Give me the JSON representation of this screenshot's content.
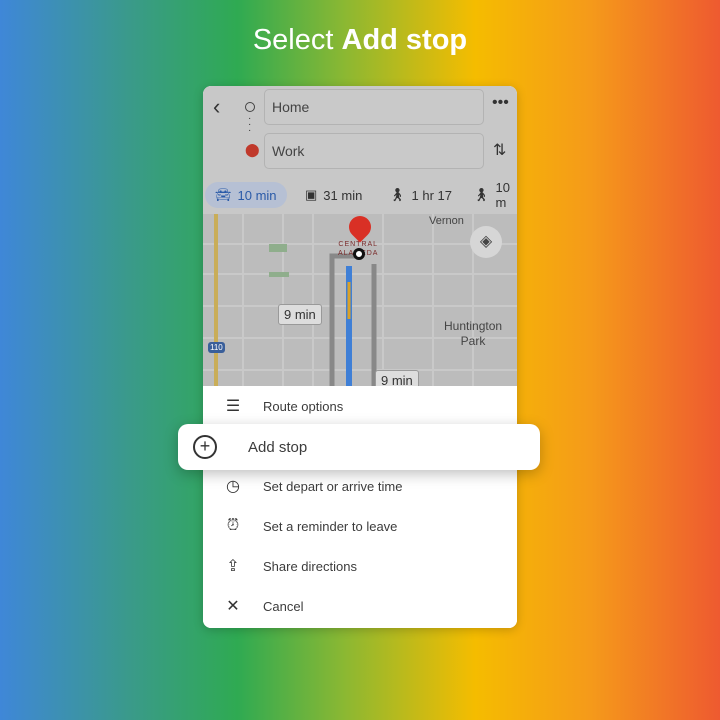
{
  "title": {
    "prefix": "Select ",
    "bold": "Add stop"
  },
  "header": {
    "origin": "Home",
    "destination": "Work"
  },
  "modes": [
    {
      "label": "10 min",
      "icon": "car-icon"
    },
    {
      "label": "31 min",
      "icon": "transit-icon"
    },
    {
      "label": "1 hr 17",
      "icon": "walk-icon"
    },
    {
      "label": "10 m",
      "icon": "rideshare-icon"
    }
  ],
  "map": {
    "label_vernon": "Vernon",
    "label_central1": "CENTRAL",
    "label_central2": "ALAMEDA",
    "label_huntington1": "Huntington",
    "label_huntington2": "Park",
    "route_time_1": "9 min",
    "route_time_2": "9 min",
    "highway": "110"
  },
  "menu": {
    "route_options": "Route options",
    "add_stop": "Add stop",
    "depart": "Set depart or arrive time",
    "reminder": "Set a reminder to leave",
    "share": "Share directions",
    "cancel": "Cancel"
  },
  "colors": {
    "route": "#3f7fd6",
    "pin": "#d93025",
    "selected_mode": "#2a5aa8"
  }
}
